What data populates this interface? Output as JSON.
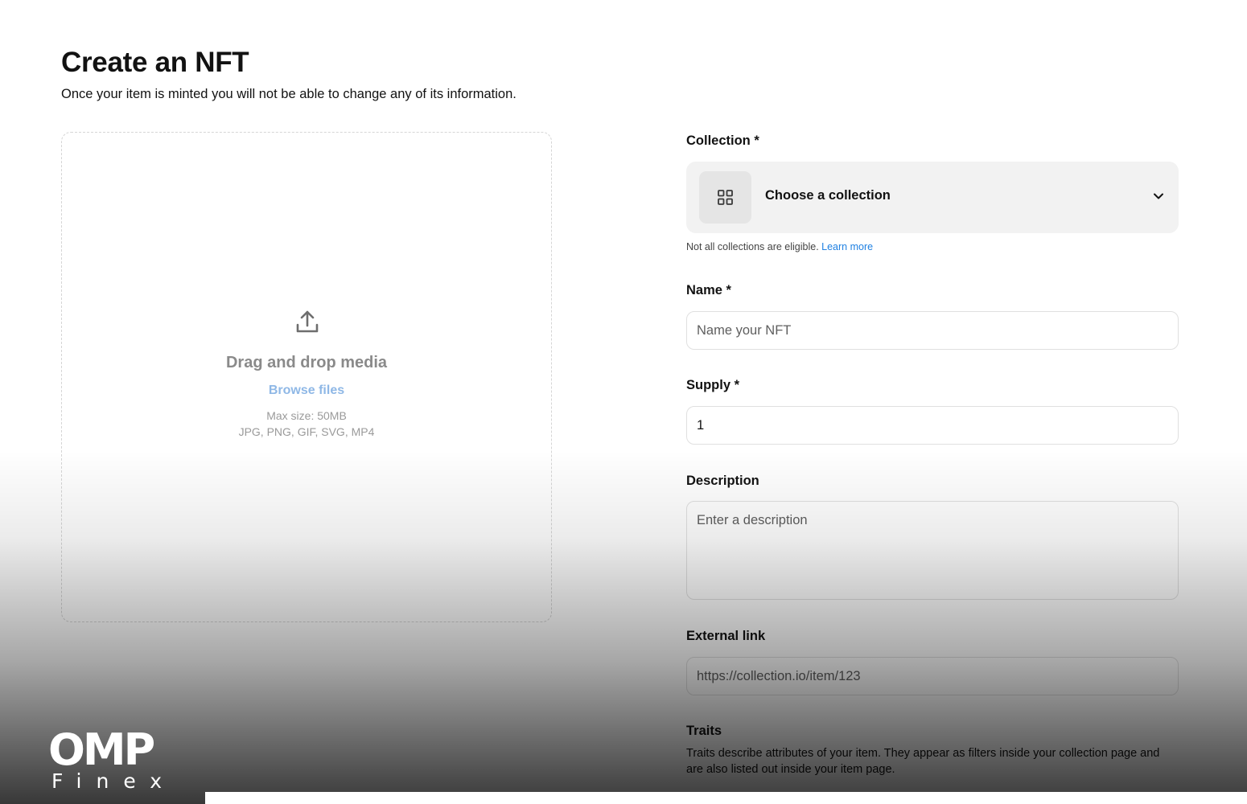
{
  "page": {
    "title": "Create an NFT",
    "subtitle": "Once your item is minted you will not be able to change any of its information."
  },
  "upload": {
    "icon": "upload-icon",
    "title": "Drag and drop media",
    "browse_label": "Browse files",
    "max_size": "Max size: 50MB",
    "formats": "JPG, PNG, GIF, SVG, MP4"
  },
  "form": {
    "collection": {
      "label": "Collection *",
      "icon": "grid-icon",
      "placeholder": "Choose a collection",
      "helper_text": "Not all collections are eligible.",
      "helper_link": "Learn more"
    },
    "name": {
      "label": "Name *",
      "placeholder": "Name your NFT",
      "value": ""
    },
    "supply": {
      "label": "Supply *",
      "value": "1"
    },
    "description": {
      "label": "Description",
      "placeholder": "Enter a description",
      "value": ""
    },
    "external_link": {
      "label": "External link",
      "placeholder": "https://collection.io/item/123",
      "value": ""
    },
    "traits": {
      "label": "Traits",
      "description": "Traits describe attributes of your item. They appear as filters inside your collection page and are also listed out inside your item page."
    }
  },
  "watermark": {
    "main": "OMP",
    "sub": "Finex"
  },
  "colors": {
    "accent_link": "#2081e2",
    "browse_link": "#8fb8e6",
    "select_bg": "#f2f2f2",
    "text": "#121212"
  }
}
